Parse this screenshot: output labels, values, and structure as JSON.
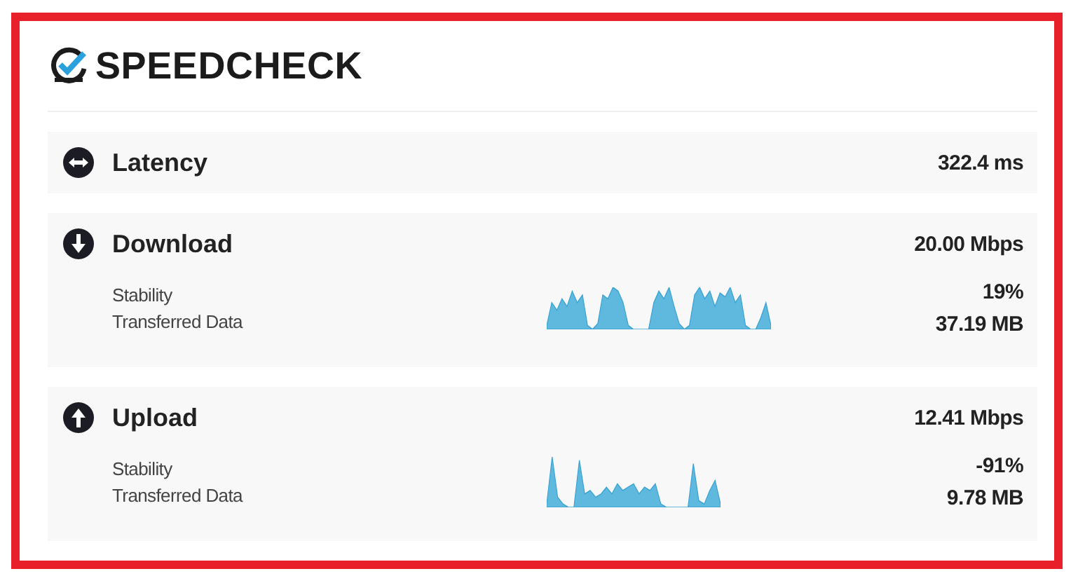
{
  "brand": {
    "name": "SPEEDCHECK"
  },
  "metrics": [
    {
      "kind": "latency",
      "label": "Latency",
      "value": "322.4 ms"
    },
    {
      "kind": "download",
      "label": "Download",
      "value": "20.00 Mbps",
      "details": [
        {
          "label": "Stability",
          "value": "19%"
        },
        {
          "label": "Transferred Data",
          "value": "37.19 MB"
        }
      ]
    },
    {
      "kind": "upload",
      "label": "Upload",
      "value": "12.41 Mbps",
      "details": [
        {
          "label": "Stability",
          "value": "-91%"
        },
        {
          "label": "Transferred Data",
          "value": "9.78 MB"
        }
      ]
    }
  ]
}
